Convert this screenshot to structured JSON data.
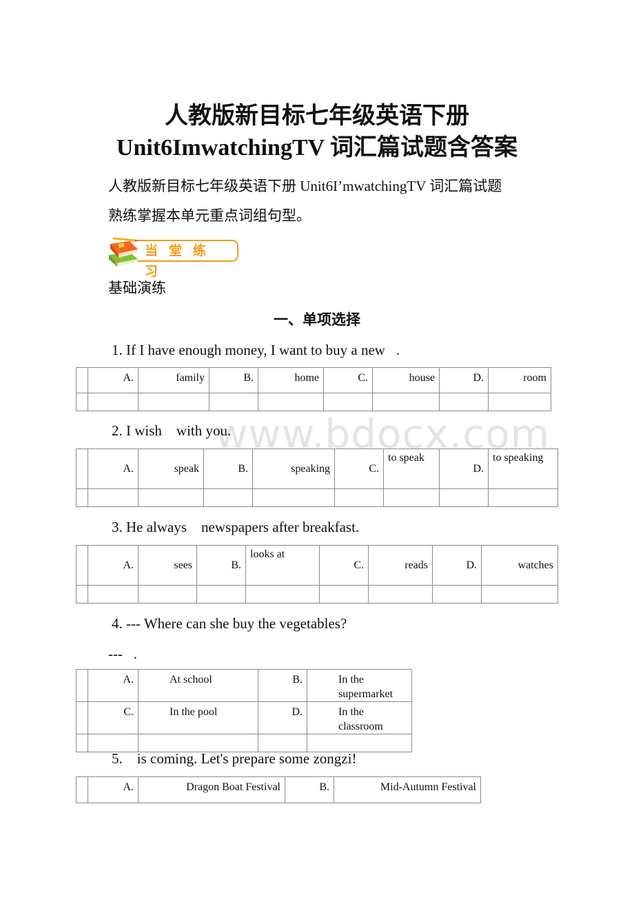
{
  "doc": {
    "title_line1": "人教版新目标七年级英语下册",
    "title_line2": "Unit6ImwatchingTV 词汇篇试题含答案",
    "intro_line1": "人教版新目标七年级英语下册 Unit6I’mwatchingTV 词汇篇试题",
    "intro_line2": "熟练掌握本单元重点词组句型。",
    "badge_label": "当堂练习",
    "badge_icon": "books-pencil-icon",
    "section_label": "基础演练",
    "section_heading": "一、单项选择",
    "watermark": "www.bdocx.com",
    "accent_color": "#f39a17"
  },
  "questions": [
    {
      "text": "1. If I have enough money, I want to buy a new   .",
      "options": [
        {
          "letter": "A.",
          "text": "family"
        },
        {
          "letter": "B.",
          "text": "home"
        },
        {
          "letter": "C.",
          "text": "house"
        },
        {
          "letter": "D.",
          "text": "room"
        }
      ]
    },
    {
      "text": "2. I wish    with you.",
      "options": [
        {
          "letter": "A.",
          "text": "speak"
        },
        {
          "letter": "B.",
          "text": "speaking"
        },
        {
          "letter": "C.",
          "text": "to speak"
        },
        {
          "letter": "D.",
          "text": "to speaking"
        }
      ]
    },
    {
      "text": "3. He always    newspapers after breakfast.",
      "options": [
        {
          "letter": "A.",
          "text": "sees"
        },
        {
          "letter": "B.",
          "text": "looks at"
        },
        {
          "letter": "C.",
          "text": "reads"
        },
        {
          "letter": "D.",
          "text": "watches"
        }
      ]
    },
    {
      "text": "4. --- Where can she buy the vegetables?",
      "answer_line": "---   .",
      "options": [
        {
          "letter": "A.",
          "text": "At school"
        },
        {
          "letter": "B.",
          "text": "In the supermarket"
        },
        {
          "letter": "C.",
          "text": "In the pool"
        },
        {
          "letter": "D.",
          "text": "In the classroom"
        }
      ]
    },
    {
      "text": "5.    is coming. Let's prepare some zongzi!",
      "options": [
        {
          "letter": "A.",
          "text": "Dragon Boat Festival"
        },
        {
          "letter": "B.",
          "text": "Mid-Autumn Festival"
        }
      ]
    }
  ]
}
